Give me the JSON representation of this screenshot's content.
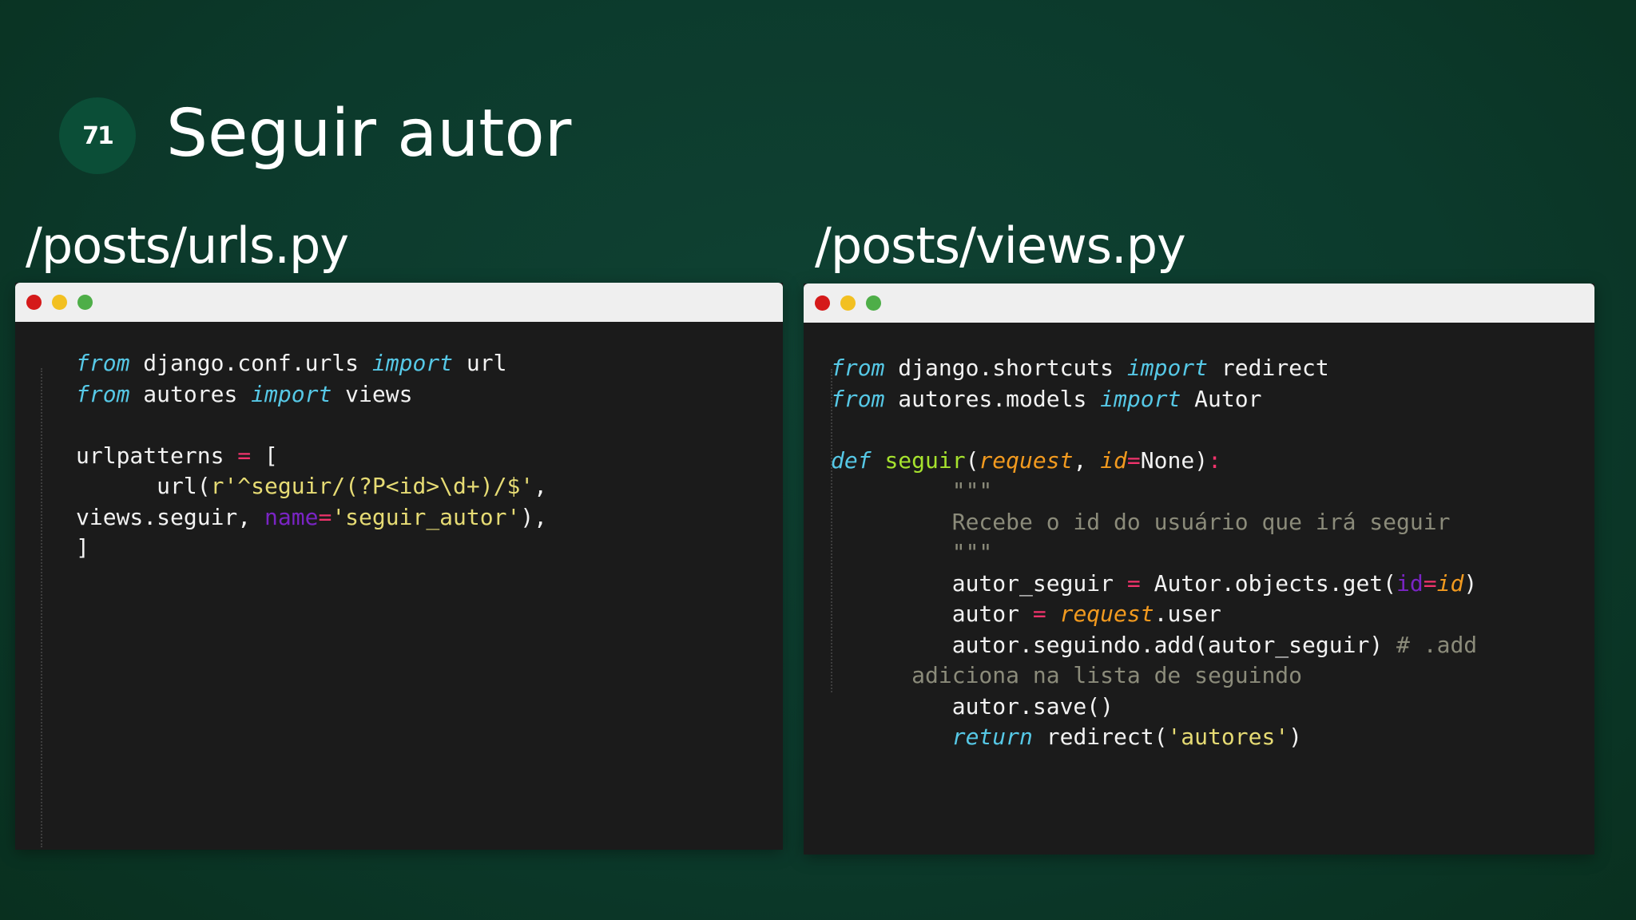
{
  "slide": {
    "number": "71",
    "title": "Seguir autor"
  },
  "panels": {
    "left": {
      "heading": "/posts/urls.py",
      "lines": [
        [
          "from",
          " django.conf.urls ",
          "import",
          " url"
        ],
        [
          "from",
          " autores ",
          "import",
          " views"
        ],
        [],
        [
          "urlpatterns ",
          "=",
          " ["
        ],
        [
          "      url(",
          "r'^seguir/(?P<id>\\d+)/$'",
          ","
        ],
        [
          "views.seguir, ",
          "name",
          "=",
          "'seguir_autor'",
          "),"
        ],
        [
          "]"
        ]
      ]
    },
    "right": {
      "heading": "/posts/views.py",
      "lines": [
        [
          "from",
          " django.shortcuts ",
          "import",
          " redirect"
        ],
        [
          "from",
          " autores.models ",
          "import",
          " Autor"
        ],
        [],
        [
          "def",
          " ",
          "seguir",
          "(",
          "request",
          ", ",
          "id",
          "=",
          "None",
          ")",
          ":"
        ],
        [
          "         \"\"\""
        ],
        [
          "         Recebe o id do usuário que irá seguir"
        ],
        [
          "         \"\"\""
        ],
        [
          "         autor_seguir ",
          "=",
          " Autor.objects.get(",
          "id",
          "=",
          "id",
          ")"
        ],
        [
          "         autor ",
          "=",
          " ",
          "request",
          ".user"
        ],
        [
          "         autor.seguindo.add(autor_seguir) ",
          "# .add"
        ],
        [
          "      adiciona na lista de seguindo"
        ],
        [
          "         autor.save()"
        ],
        [
          "         ",
          "return",
          " redirect(",
          "'autores'",
          ")"
        ]
      ]
    }
  },
  "colors": {
    "background": "#0c3a2c",
    "badge": "#0b4e37",
    "code_bg": "#1b1b1b",
    "titlebar": "#efefef",
    "dot_red": "#d51a1a",
    "dot_yellow": "#f2c021",
    "dot_green": "#4eae48",
    "keyword": "#56c8e6",
    "operator": "#f0336b",
    "string": "#e6db74",
    "kwarg": "#7a24c4",
    "function": "#a6e22e",
    "param": "#f29a1f",
    "comment": "#8b8b7a"
  }
}
